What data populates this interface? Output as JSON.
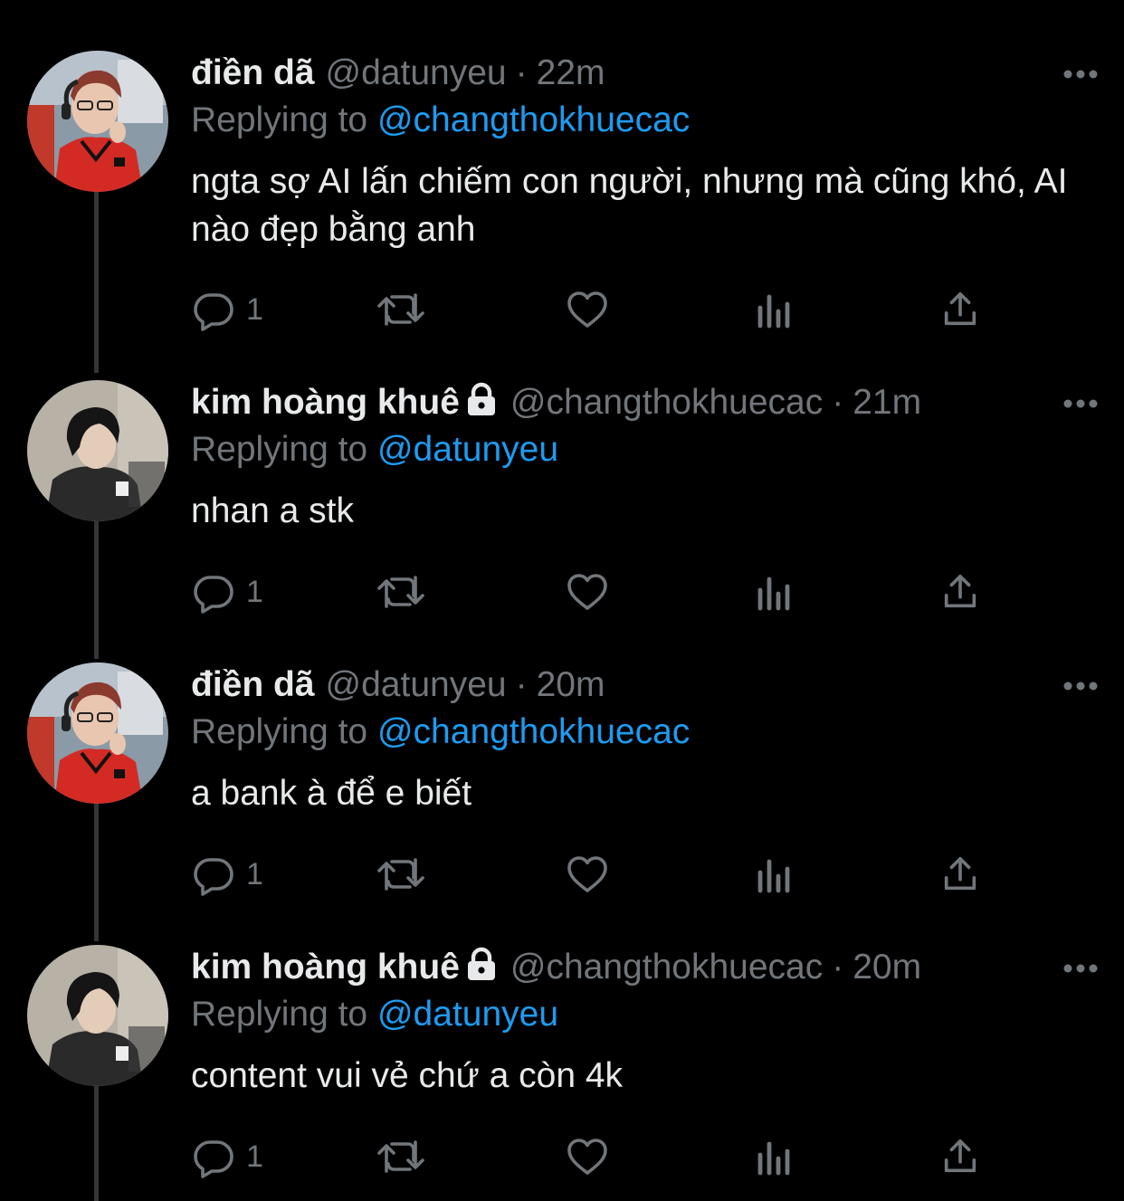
{
  "thread": [
    {
      "name": "điền dã",
      "locked": false,
      "handle": "@datunyeu",
      "separator": "·",
      "time": "22m",
      "replying_prefix": "Replying to",
      "replying_to": "@changthokhuecac",
      "text": "ngta sợ AI lấn chiếm con người, nhưng mà cũng khó, AI nào đẹp bằng anh",
      "reply_count": "1",
      "avatar": "red-jersey-gamer-avatar"
    },
    {
      "name": "kim hoàng khuê",
      "locked": true,
      "handle": "@changthokhuecac",
      "separator": "·",
      "time": "21m",
      "replying_prefix": "Replying to",
      "replying_to": "@datunyeu",
      "text": "nhan a stk",
      "reply_count": "1",
      "avatar": "dark-hair-profile-avatar"
    },
    {
      "name": "điền dã",
      "locked": false,
      "handle": "@datunyeu",
      "separator": "·",
      "time": "20m",
      "replying_prefix": "Replying to",
      "replying_to": "@changthokhuecac",
      "text": "a bank à để e biết",
      "reply_count": "1",
      "avatar": "red-jersey-gamer-avatar"
    },
    {
      "name": "kim hoàng khuê",
      "locked": true,
      "handle": "@changthokhuecac",
      "separator": "·",
      "time": "20m",
      "replying_prefix": "Replying to",
      "replying_to": "@datunyeu",
      "text": "content vui vẻ chứ a còn 4k",
      "reply_count": "1",
      "avatar": "dark-hair-profile-avatar"
    }
  ],
  "icons": {
    "reply": "reply-icon",
    "retweet": "retweet-icon",
    "like": "heart-icon",
    "views": "analytics-icon",
    "share": "share-icon",
    "more": "more-icon",
    "lock": "lock-icon"
  },
  "colors": {
    "background": "#000000",
    "text": "#e7e9ea",
    "secondary": "#71767b",
    "mention": "#1d9bf0",
    "thread_line": "#333639"
  }
}
